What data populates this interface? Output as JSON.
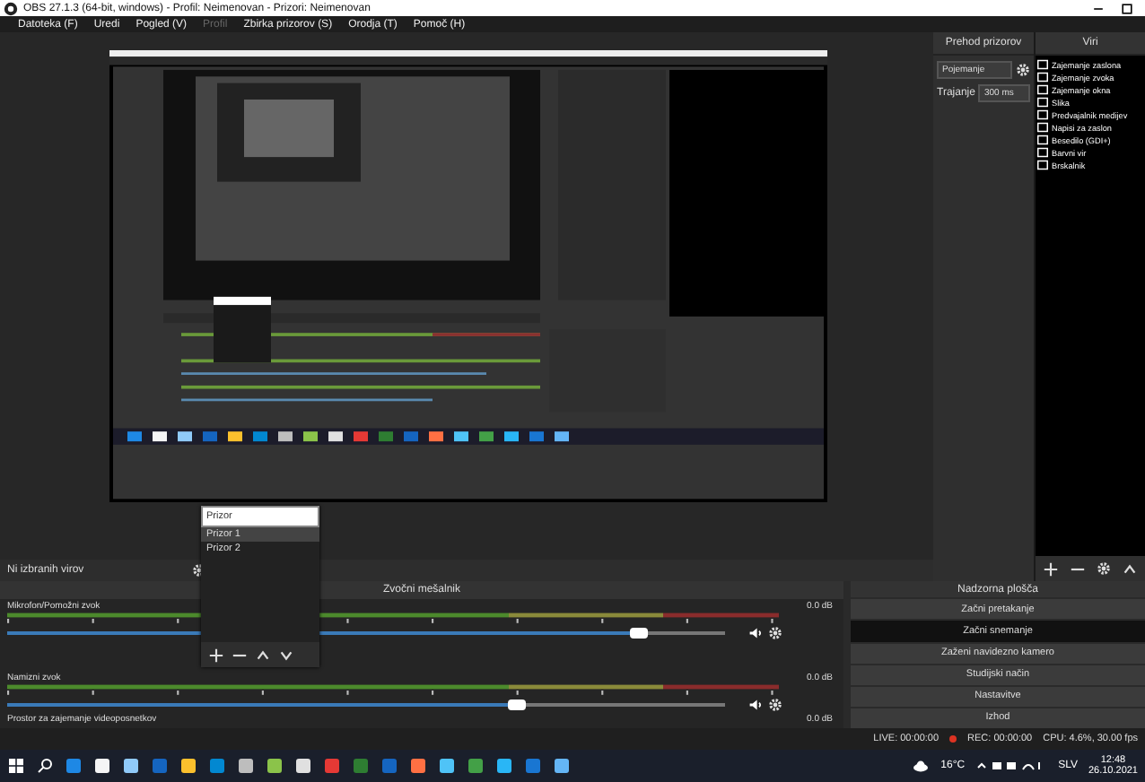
{
  "window": {
    "title": "OBS 27.1.3 (64-bit, windows) - Profil: Neimenovan - Prizori: Neimenovan"
  },
  "menu": [
    {
      "label": "Datoteka (F)",
      "disabled": false
    },
    {
      "label": "Uredi",
      "disabled": false
    },
    {
      "label": "Pogled (V)",
      "disabled": false
    },
    {
      "label": "Profil",
      "disabled": true
    },
    {
      "label": "Zbirka prizorov (S)",
      "disabled": false
    },
    {
      "label": "Orodja (T)",
      "disabled": false
    },
    {
      "label": "Pomoč (H)",
      "disabled": false
    }
  ],
  "transitions": {
    "title": "Prehod prizorov",
    "transition": "Pojemanje",
    "duration_label": "Trajanje",
    "duration": "300 ms"
  },
  "sources": {
    "title": "Viri",
    "items": [
      {
        "label": "Zajemanje zaslona"
      },
      {
        "label": "Zajemanje zvoka"
      },
      {
        "label": "Zajemanje okna"
      },
      {
        "label": "Slika"
      },
      {
        "label": "Predvajalnik medijev"
      },
      {
        "label": "Napisi za zaslon"
      },
      {
        "label": "Besedilo (GDI+)"
      },
      {
        "label": "Barvni vir"
      },
      {
        "label": "Brskalnik"
      }
    ]
  },
  "no_source_label": "Ni izbranih virov",
  "scene_popup": {
    "value": "Prizor",
    "items": [
      {
        "label": "Prizor 1",
        "selected": true
      },
      {
        "label": "Prizor 2",
        "selected": false
      }
    ]
  },
  "mixer": {
    "title": "Zvočni mešalnik",
    "channels": [
      {
        "name": "Mikrofon/Pomožni zvok",
        "reading": "0.0 dB",
        "level": 0.88
      },
      {
        "name": "Namizni zvok",
        "reading": "0.0 dB",
        "level": 0.71
      },
      {
        "name": "Prostor za zajemanje videoposnetkov",
        "reading": "0.0 dB"
      }
    ]
  },
  "controls": {
    "title": "Nadzorna plošča",
    "buttons": [
      {
        "label": "Začni pretakanje",
        "selected": false
      },
      {
        "label": "Začni snemanje",
        "selected": true
      },
      {
        "label": "Zaženi navidezno kamero",
        "selected": false
      },
      {
        "label": "Studijski način",
        "selected": false
      },
      {
        "label": "Nastavitve",
        "selected": false
      },
      {
        "label": "Izhod",
        "selected": false
      }
    ]
  },
  "status": {
    "live": "LIVE: 00:00:00",
    "rec": "REC: 00:00:00",
    "cpu": "CPU: 4.6%, 30.00 fps"
  },
  "taskbar": {
    "weather": "16°C",
    "language": "SLV",
    "time": "12:48",
    "date": "26.10.2021"
  }
}
